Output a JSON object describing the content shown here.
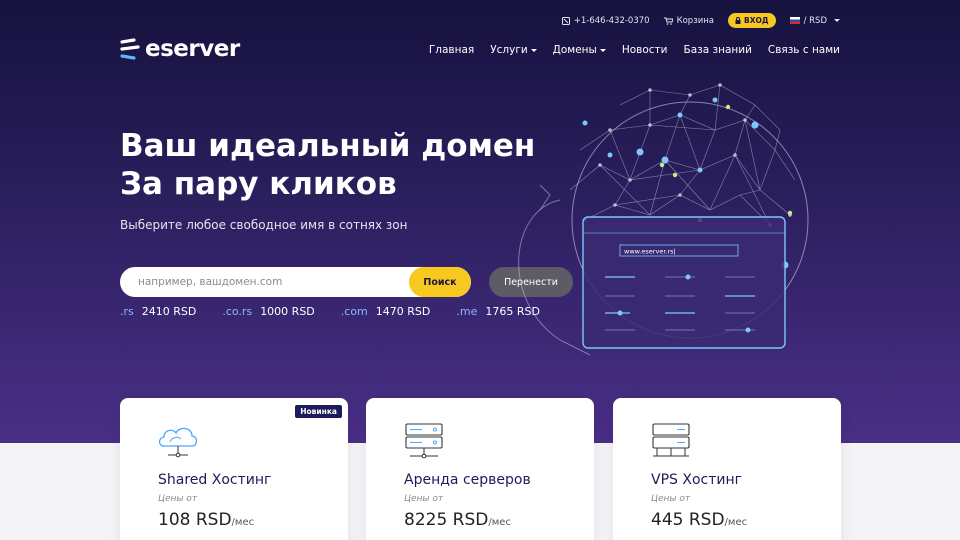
{
  "topbar": {
    "phone": "+1-646-432-0370",
    "cart_label": "Корзина",
    "login_label": "ВХОД",
    "currency_label": "/ RSD"
  },
  "logo": {
    "text": "eserver"
  },
  "nav": {
    "items": [
      {
        "label": "Главная"
      },
      {
        "label": "Услуги"
      },
      {
        "label": "Домены"
      },
      {
        "label": "Новости"
      },
      {
        "label": "База знаний"
      },
      {
        "label": "Связь с нами"
      }
    ]
  },
  "hero": {
    "title_line1": "Ваш идеальный домен",
    "title_line2": "За пару кликов",
    "subtitle": "Выберите любое свободное имя в сотнях зон",
    "illustration_url": "www.eserver.rs|"
  },
  "search": {
    "placeholder": "например, вашдомен.com",
    "value": "",
    "button_label": "Поиск",
    "transfer_label": "Перенести"
  },
  "prices": [
    {
      "zone": ".rs",
      "price": "2410 RSD"
    },
    {
      "zone": ".co.rs",
      "price": "1000 RSD"
    },
    {
      "zone": ".com",
      "price": "1470 RSD"
    },
    {
      "zone": ".me",
      "price": "1765 RSD"
    }
  ],
  "cards": [
    {
      "title": "Shared Хостинг",
      "from": "Цены от",
      "price": "108 RSD",
      "unit": "/мес",
      "badge": "Новинка",
      "icon": "cloud-server-icon"
    },
    {
      "title": "Аренда серверов",
      "from": "Цены от",
      "price": "8225 RSD",
      "unit": "/мес",
      "icon": "dedicated-server-icon"
    },
    {
      "title": "VPS Хостинг",
      "from": "Цены от",
      "price": "445 RSD",
      "unit": "/мес",
      "icon": "vps-server-icon"
    }
  ],
  "colors": {
    "accent_yellow": "#f7c81f",
    "hero_dark": "#16123f",
    "hero_purple": "#4a2f86",
    "card_title": "#1c1b5b",
    "zone_blue": "#8ab8ff"
  }
}
